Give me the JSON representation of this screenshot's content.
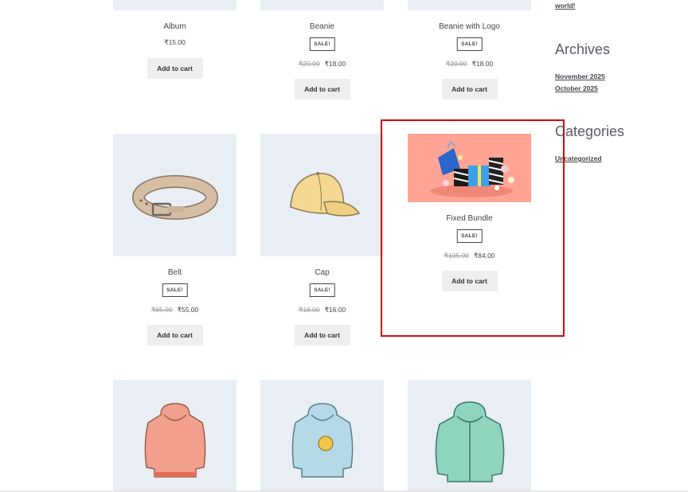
{
  "products": [
    {
      "title": "Album",
      "sale": false,
      "price": "₹15.00",
      "button": "Add to cart"
    },
    {
      "title": "Beanie",
      "sale": true,
      "badge": "SALE!",
      "old_price": "₹20.00",
      "price": "₹18.00",
      "button": "Add to cart"
    },
    {
      "title": "Beanie with Logo",
      "sale": true,
      "badge": "SALE!",
      "old_price": "₹20.00",
      "price": "₹18.00",
      "button": "Add to cart"
    },
    {
      "title": "Belt",
      "sale": true,
      "badge": "SALE!",
      "old_price": "₹65.00",
      "price": "₹55.00",
      "button": "Add to cart",
      "image": "belt-icon"
    },
    {
      "title": "Cap",
      "sale": true,
      "badge": "SALE!",
      "old_price": "₹18.00",
      "price": "₹16.00",
      "button": "Add to cart",
      "image": "cap-icon"
    },
    {
      "title": "Fixed Bundle",
      "sale": true,
      "badge": "SALE!",
      "old_price": "₹105.00",
      "price": "₹84.00",
      "button": "Add to cart",
      "image": "gift-bundle-icon"
    },
    {
      "image": "hoodie-icon",
      "color": "#f2a08d"
    },
    {
      "image": "hoodie-with-logo-icon",
      "color": "#b6d9e8"
    },
    {
      "image": "zip-hoodie-icon",
      "color": "#8fd4bd"
    }
  ],
  "sidebar": {
    "recent_post_tail": "world!",
    "archives_title": "Archives",
    "archives": [
      "November 2025",
      "October 2025"
    ],
    "categories_title": "Categories",
    "categories": [
      "Uncategorized"
    ]
  },
  "colors": {
    "thumb_bg": "#e8eef3",
    "highlight": "#d10a0a",
    "button_bg": "#eeeeee"
  }
}
